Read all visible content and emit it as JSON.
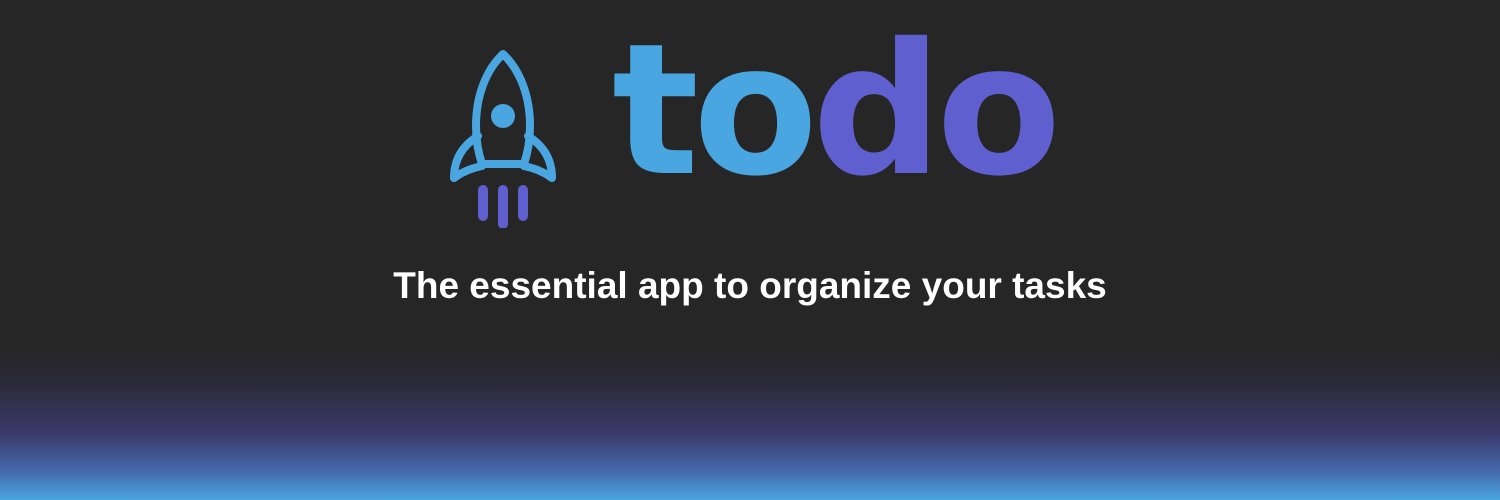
{
  "brand": {
    "icon": "rocket-icon",
    "wordmark_part_1": "to",
    "wordmark_part_2": "do",
    "tagline": "The essential app to organize your tasks"
  },
  "colors": {
    "background": "#262626",
    "primary_blue": "#4aa6e0",
    "accent_purple": "#5f5fcf",
    "tagline_text": "#ffffff"
  }
}
